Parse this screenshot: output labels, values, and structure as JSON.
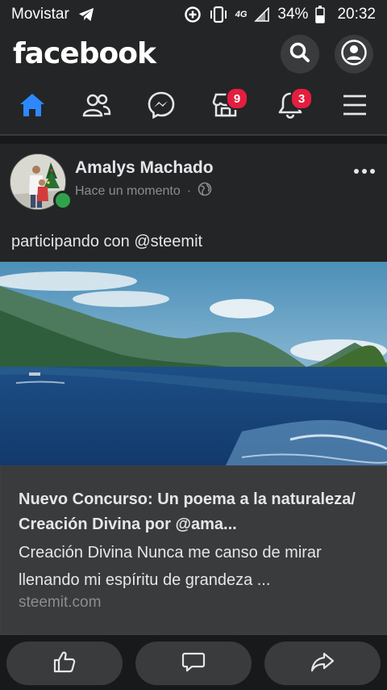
{
  "status_bar": {
    "carrier": "Movistar",
    "network": "4G",
    "battery": "34%",
    "time": "20:32"
  },
  "header": {
    "logo": "facebook",
    "icons": [
      "search-icon",
      "profile-icon"
    ]
  },
  "nav": {
    "items": [
      {
        "name": "home",
        "icon": "home-icon",
        "active": true
      },
      {
        "name": "friends",
        "icon": "friends-icon"
      },
      {
        "name": "messenger",
        "icon": "messenger-icon"
      },
      {
        "name": "marketplace",
        "icon": "marketplace-icon",
        "badge": "9"
      },
      {
        "name": "notifications",
        "icon": "bell-icon",
        "badge": "3"
      },
      {
        "name": "menu",
        "icon": "menu-icon"
      }
    ]
  },
  "colors": {
    "accent": "#2d88ff",
    "badge": "#e41e3f",
    "online": "#31a24c",
    "surface": "#242526",
    "background": "#18191a"
  },
  "post": {
    "author": "Amalys Machado",
    "time": "Hace un momento",
    "separator": "·",
    "privacy_icon": "globe-icon",
    "text": "participando con @steemit",
    "link": {
      "title": "Nuevo Concurso: Un poema a la naturaleza/ Creación Divina por @ama...",
      "description": "Creación Divina Nunca me canso de mirar llenando mi espíritu de grandeza ...",
      "domain": "steemit.com"
    },
    "actions": [
      "like-icon",
      "comment-icon",
      "share-icon"
    ]
  }
}
